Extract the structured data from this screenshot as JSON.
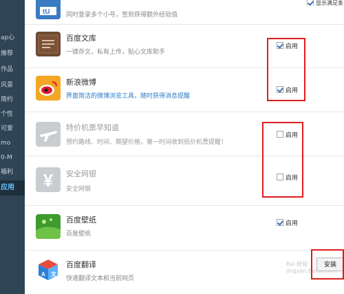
{
  "sidebar": {
    "items": [
      {
        "label": "ap心"
      },
      {
        "label": "推荐"
      },
      {
        "label": "作品"
      },
      {
        "label": "风景"
      },
      {
        "label": "简约"
      },
      {
        "label": "个性"
      },
      {
        "label": "可爱"
      },
      {
        "label": "mo"
      },
      {
        "label": "0-M"
      },
      {
        "label": "福利"
      },
      {
        "label": "应用"
      }
    ]
  },
  "top": {
    "show_label": "显示满足条",
    "partial_desc": "同时登录多个小号，签到获得额外经验值"
  },
  "apps": [
    {
      "name": "百度文库",
      "desc": "一键存文，私有上传，贴心文库助手",
      "action": "启用",
      "checked": true,
      "disabled": false,
      "icon": "library-book-icon"
    },
    {
      "name": "新浪微博",
      "desc": "界面简洁的微博浏览工具，随时获得消息提醒",
      "action": "启用",
      "checked": true,
      "disabled": false,
      "icon": "weibo-icon"
    },
    {
      "name": "特价机票早知道",
      "desc": "预约路线、时间、期望价格，第一时间收到低价机票提醒！",
      "action": "启用",
      "checked": false,
      "disabled": true,
      "icon": "airplane-icon"
    },
    {
      "name": "安全网银",
      "desc": "安全网银",
      "action": "启用",
      "checked": false,
      "disabled": true,
      "icon": "yen-icon"
    },
    {
      "name": "百度壁纸",
      "desc": "百度壁纸",
      "action": "启用",
      "checked": true,
      "disabled": false,
      "icon": "wallpaper-icon"
    },
    {
      "name": "百度翻译",
      "desc": "快速翻译文本和当前网页",
      "action": "安装",
      "disabled": false,
      "icon": "translate-cube-icon"
    }
  ],
  "watermark": "Bai 经验 jingyan.baidu.com",
  "colors": {
    "sidebar": "#2f4454",
    "highlight": "#e01b1b",
    "active_text": "#5fc2ff"
  }
}
